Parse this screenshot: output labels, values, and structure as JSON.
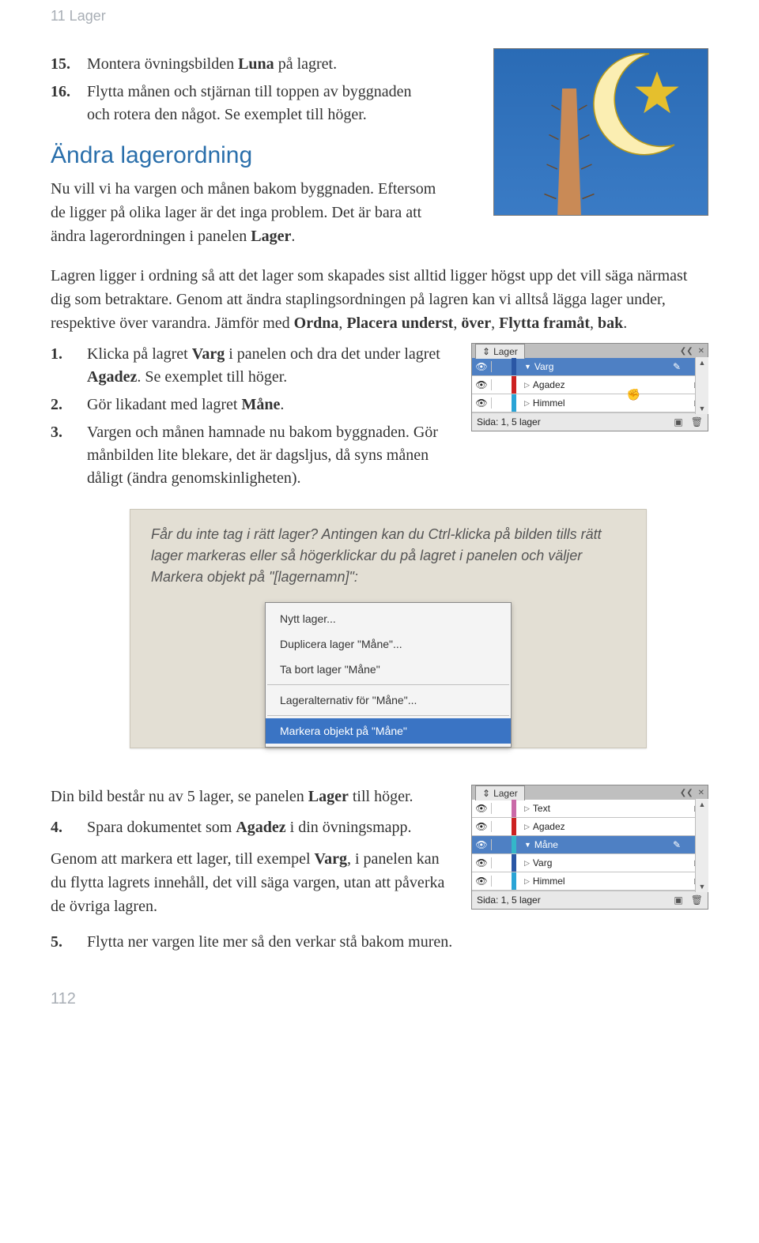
{
  "header": "11 Lager",
  "steps_top": [
    {
      "n": "15.",
      "before": "Montera övningsbilden ",
      "b": "Luna",
      "after": " på lagret."
    },
    {
      "n": "16.",
      "text": "Flytta månen och stjärnan till toppen av byggnaden och rotera den något. Se exemplet till höger."
    }
  ],
  "section_heading": "Ändra lagerordning",
  "p_intro_1_a": "Nu vill vi ha vargen och månen bakom byggnaden. Eftersom de ligger på olika lager är det inga problem. Det är bara att ändra lagerordningen i panelen ",
  "p_intro_1_b": "Lager",
  "p_intro_1_c": ".",
  "p_intro_2_a": "Lagren ligger i ordning så att det lager som skapades sist alltid ligger högst upp det vill säga närmast dig som betraktare. Genom att ändra staplingsordningen på lagren kan vi alltså lägga lager under, respektive över varandra. Jämför med ",
  "p_intro_2_b": "Ordna",
  "p_intro_2_c": ", ",
  "p_intro_2_d": "Placera underst",
  "p_intro_2_e": ", ",
  "p_intro_2_f": "över",
  "p_intro_2_g": ", ",
  "p_intro_2_h": "Flytta framåt",
  "p_intro_2_i": ", ",
  "p_intro_2_j": "bak",
  "p_intro_2_k": ".",
  "steps_mid": [
    {
      "n": "1.",
      "a": "Klicka på lagret ",
      "b1": "Varg",
      "c": " i panelen och dra det under lagret ",
      "b2": "Agadez",
      "d": ". Se exemplet till höger."
    },
    {
      "n": "2.",
      "a": "Gör likadant med lagret ",
      "b1": "Måne",
      "c": "."
    },
    {
      "n": "3.",
      "a": "Vargen och månen hamnade nu bakom byggnaden. Gör månbilden lite blekare, det är dagsljus, då syns månen dåligt (ändra genomskinligheten)."
    }
  ],
  "panel3": {
    "tab": "Lager",
    "rows": [
      {
        "sel": true,
        "color": "#2a57a5",
        "tri": "▼",
        "name": "Varg",
        "end": "✎",
        "square": "■"
      },
      {
        "sel": false,
        "color": "#c22",
        "tri": "▷",
        "name": "Agadez",
        "square": "□"
      },
      {
        "sel": false,
        "color": "#2aa4d6",
        "tri": "▷",
        "name": "Himmel",
        "square": "□"
      }
    ],
    "status": "Sida: 1, 5 lager"
  },
  "tip_text": "Får du inte tag i rätt lager? Antingen kan du Ctrl-klicka på bilden tills rätt lager markeras eller så högerklickar du på lagret i panelen och väljer Markera objekt på \"[lagernamn]\":",
  "ctx_menu": {
    "items": [
      {
        "t": "Nytt lager..."
      },
      {
        "t": "Duplicera lager \"Måne\"..."
      },
      {
        "t": "Ta bort lager \"Måne\""
      },
      {
        "sep": true
      },
      {
        "t": "Lageralternativ för \"Måne\"..."
      },
      {
        "sep": true
      },
      {
        "t": "Markera objekt på \"Måne\"",
        "sel": true
      }
    ]
  },
  "p_after_a": "Din bild består nu av 5 lager, se panelen ",
  "p_after_b": "Lager",
  "p_after_c": " till höger.",
  "steps_low": [
    {
      "n": "4.",
      "a": "Spara dokumentet som ",
      "b1": "Agadez",
      "c": " i din övningsmapp."
    }
  ],
  "p_after2_a": "Genom att markera ett lager, till exempel ",
  "p_after2_b": "Varg",
  "p_after2_c": ", i panelen kan du flytta lagrets innehåll, det vill säga vargen, utan att påverka de övriga lagren.",
  "steps_last": [
    {
      "n": "5.",
      "a": "Flytta ner vargen lite mer så den verkar stå bakom muren."
    }
  ],
  "panel5": {
    "tab": "Lager",
    "rows": [
      {
        "sel": false,
        "color": "#ca6aa8",
        "tri": "▷",
        "name": "Text",
        "square": "□"
      },
      {
        "sel": false,
        "color": "#c22",
        "tri": "▷",
        "name": "Agadez",
        "square": "■",
        "sqcolor": "#c22"
      },
      {
        "sel": true,
        "color": "#34b7c9",
        "tri": "▼",
        "name": "Måne",
        "end": "✎",
        "square": "■"
      },
      {
        "sel": false,
        "color": "#2a57a5",
        "tri": "▷",
        "name": "Varg",
        "square": "□"
      },
      {
        "sel": false,
        "color": "#2aa4d6",
        "tri": "▷",
        "name": "Himmel",
        "square": "□"
      }
    ],
    "status": "Sida: 1, 5 lager"
  },
  "page_number": "112",
  "icons": {
    "eye": "👁",
    "arrows": "❮❮",
    "x": "✕",
    "menu": "≡",
    "new": "▣",
    "trash": "🗑",
    "up": "▲",
    "down": "▼",
    "updown": "⇕"
  }
}
